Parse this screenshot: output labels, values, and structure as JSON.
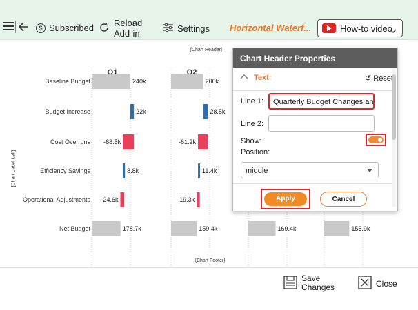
{
  "toolbar": {
    "subscribed_label": "Subscribed",
    "reload_label": "Reload Add-in",
    "reload_line1": "Reload",
    "reload_line2": "Add-in",
    "settings_label": "Settings",
    "chart_title": "Horizontal Waterf...",
    "howto_label": "How-to video"
  },
  "chart": {
    "header_placeholder": "[Chart Header]",
    "footer_placeholder": "[Chart Footer]",
    "label_left_placeholder": "[Chart Label Left]"
  },
  "chart_data": {
    "type": "bar",
    "categories": [
      "Baseline Budget",
      "Budget Increase",
      "Cost Overruns",
      "Efficiency Savings",
      "Operational Adjustments",
      "Net Budget"
    ],
    "series": [
      {
        "name": "Q1",
        "values": [
          240,
          22,
          -68.5,
          8.8,
          -24.6,
          178.7
        ],
        "labels": [
          "240k",
          "22k",
          "-68.5k",
          "8.8k",
          "-24.6k",
          "178.7k"
        ]
      },
      {
        "name": "Q2",
        "values": [
          200,
          28.5,
          -61.2,
          11.4,
          -19.3,
          159.4
        ],
        "labels": [
          "200k",
          "28.5k",
          "-61.2k",
          "11.4k",
          "-19.3k",
          "159.4k"
        ]
      },
      {
        "name": "",
        "values": [
          169.4
        ],
        "labels": [
          "169.4k"
        ]
      },
      {
        "name": "",
        "values": [
          155.9
        ],
        "labels": [
          "155.9k"
        ]
      }
    ],
    "colors": {
      "base": "#c9c9c9",
      "increase": "#2f6fb0",
      "decrease": "#e8405a"
    }
  },
  "panel": {
    "title": "Chart Header Properties",
    "section_label": "Text:",
    "reset_label": "Reset",
    "line1_label": "Line 1:",
    "line1_value": "Quarterly Budget Changes and",
    "line2_label": "Line 2:",
    "line2_value": "",
    "show_label": "Show:",
    "show_value": true,
    "position_label": "Position:",
    "position_value": "middle",
    "apply_label": "Apply",
    "cancel_label": "Cancel"
  },
  "footer": {
    "save_line1": "Save",
    "save_line2": "Changes",
    "close_label": "Close"
  }
}
